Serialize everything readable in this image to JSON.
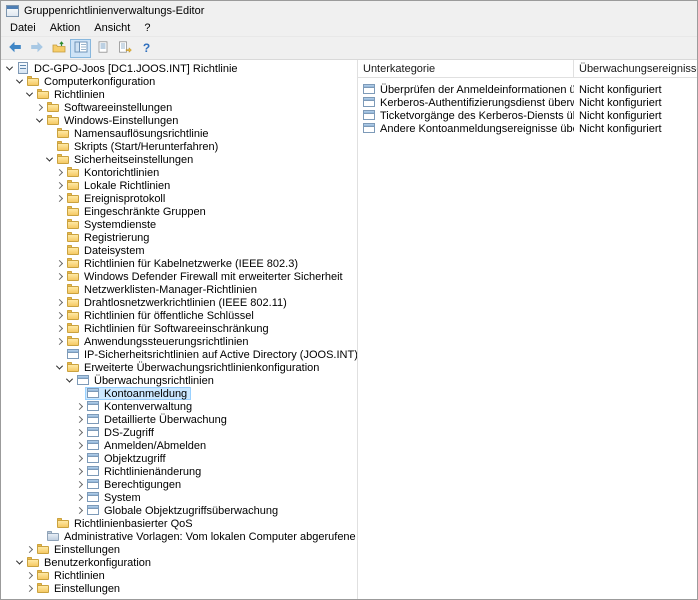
{
  "window": {
    "title": "Gruppenrichtlinienverwaltungs-Editor"
  },
  "menu": {
    "items": [
      "Datei",
      "Aktion",
      "Ansicht",
      "?"
    ]
  },
  "toolbar": {
    "icons": [
      "back-arrow",
      "forward-arrow",
      "up-one-level",
      "show-hide-console-tree",
      "properties",
      "export-list",
      "help"
    ],
    "pressed": "show-hide-console-tree"
  },
  "colors": {
    "selection_bg": "#cce8ff",
    "selection_border": "#99d1ff",
    "folder": "#f5c964"
  },
  "tree": {
    "items": [
      {
        "label": "DC-GPO-Joos [DC1.JOOS.INT] Richtlinie",
        "level": 0,
        "expand": "expanded",
        "icon": "gpo",
        "selected": false
      },
      {
        "label": "Computerkonfiguration",
        "level": 1,
        "expand": "expanded",
        "icon": "folder",
        "selected": false
      },
      {
        "label": "Richtlinien",
        "level": 2,
        "expand": "expanded",
        "icon": "folder",
        "selected": false
      },
      {
        "label": "Softwareeinstellungen",
        "level": 3,
        "expand": "collapsed",
        "icon": "folder",
        "selected": false
      },
      {
        "label": "Windows-Einstellungen",
        "level": 3,
        "expand": "expanded",
        "icon": "folder",
        "selected": false
      },
      {
        "label": "Namensauflösungsrichtlinie",
        "level": 4,
        "expand": "none",
        "icon": "folder",
        "selected": false
      },
      {
        "label": "Skripts (Start/Herunterfahren)",
        "level": 4,
        "expand": "none",
        "icon": "folder",
        "selected": false
      },
      {
        "label": "Sicherheitseinstellungen",
        "level": 4,
        "expand": "expanded",
        "icon": "folder",
        "selected": false
      },
      {
        "label": "Kontorichtlinien",
        "level": 5,
        "expand": "collapsed",
        "icon": "folder",
        "selected": false
      },
      {
        "label": "Lokale Richtlinien",
        "level": 5,
        "expand": "collapsed",
        "icon": "folder",
        "selected": false
      },
      {
        "label": "Ereignisprotokoll",
        "level": 5,
        "expand": "collapsed",
        "icon": "folder",
        "selected": false
      },
      {
        "label": "Eingeschränkte Gruppen",
        "level": 5,
        "expand": "none",
        "icon": "folder",
        "selected": false
      },
      {
        "label": "Systemdienste",
        "level": 5,
        "expand": "none",
        "icon": "folder",
        "selected": false
      },
      {
        "label": "Registrierung",
        "level": 5,
        "expand": "none",
        "icon": "folder",
        "selected": false
      },
      {
        "label": "Dateisystem",
        "level": 5,
        "expand": "none",
        "icon": "folder",
        "selected": false
      },
      {
        "label": "Richtlinien für Kabelnetzwerke (IEEE 802.3)",
        "level": 5,
        "expand": "collapsed",
        "icon": "folder",
        "selected": false
      },
      {
        "label": "Windows Defender Firewall mit erweiterter Sicherheit",
        "level": 5,
        "expand": "collapsed",
        "icon": "folder",
        "selected": false
      },
      {
        "label": "Netzwerklisten-Manager-Richtlinien",
        "level": 5,
        "expand": "none",
        "icon": "folder",
        "selected": false
      },
      {
        "label": "Drahtlosnetzwerkrichtlinien (IEEE 802.11)",
        "level": 5,
        "expand": "collapsed",
        "icon": "folder",
        "selected": false
      },
      {
        "label": "Richtlinien für öffentliche Schlüssel",
        "level": 5,
        "expand": "collapsed",
        "icon": "folder",
        "selected": false
      },
      {
        "label": "Richtlinien für Softwareeinschränkung",
        "level": 5,
        "expand": "collapsed",
        "icon": "folder",
        "selected": false
      },
      {
        "label": "Anwendungssteuerungsrichtlinien",
        "level": 5,
        "expand": "collapsed",
        "icon": "folder",
        "selected": false
      },
      {
        "label": "IP-Sicherheitsrichtlinien auf Active Directory (JOOS.INT)",
        "level": 5,
        "expand": "none",
        "icon": "audit",
        "selected": false
      },
      {
        "label": "Erweiterte Überwachungsrichtlinienkonfiguration",
        "level": 5,
        "expand": "expanded",
        "icon": "folder",
        "selected": false
      },
      {
        "label": "Überwachungsrichtlinien",
        "level": 6,
        "expand": "expanded",
        "icon": "audit",
        "selected": false
      },
      {
        "label": "Kontoanmeldung",
        "level": 7,
        "expand": "none",
        "icon": "audit",
        "selected": true
      },
      {
        "label": "Kontenverwaltung",
        "level": 7,
        "expand": "collapsed",
        "icon": "audit",
        "selected": false
      },
      {
        "label": "Detaillierte Überwachung",
        "level": 7,
        "expand": "collapsed",
        "icon": "audit",
        "selected": false
      },
      {
        "label": "DS-Zugriff",
        "level": 7,
        "expand": "collapsed",
        "icon": "audit",
        "selected": false
      },
      {
        "label": "Anmelden/Abmelden",
        "level": 7,
        "expand": "collapsed",
        "icon": "audit",
        "selected": false
      },
      {
        "label": "Objektzugriff",
        "level": 7,
        "expand": "collapsed",
        "icon": "audit",
        "selected": false
      },
      {
        "label": "Richtlinienänderung",
        "level": 7,
        "expand": "collapsed",
        "icon": "audit",
        "selected": false
      },
      {
        "label": "Berechtigungen",
        "level": 7,
        "expand": "collapsed",
        "icon": "audit",
        "selected": false
      },
      {
        "label": "System",
        "level": 7,
        "expand": "collapsed",
        "icon": "audit",
        "selected": false
      },
      {
        "label": "Globale Objektzugriffsüberwachung",
        "level": 7,
        "expand": "collapsed",
        "icon": "audit",
        "selected": false
      },
      {
        "label": "Richtlinienbasierter QoS",
        "level": 4,
        "expand": "none",
        "icon": "folder",
        "selected": false
      },
      {
        "label": "Administrative Vorlagen: Vom lokalen Computer abgerufene Richtliniendefir",
        "level": 3,
        "expand": "none",
        "icon": "admx",
        "selected": false
      },
      {
        "label": "Einstellungen",
        "level": 2,
        "expand": "collapsed",
        "icon": "folder",
        "selected": false
      },
      {
        "label": "Benutzerkonfiguration",
        "level": 1,
        "expand": "expanded",
        "icon": "folder",
        "selected": false
      },
      {
        "label": "Richtlinien",
        "level": 2,
        "expand": "collapsed",
        "icon": "folder",
        "selected": false
      },
      {
        "label": "Einstellungen",
        "level": 2,
        "expand": "collapsed",
        "icon": "folder",
        "selected": false
      }
    ]
  },
  "list": {
    "columns": [
      {
        "label": "Unterkategorie"
      },
      {
        "label": "Überwachungsereignisse"
      }
    ],
    "rows": [
      {
        "subcategory": "Überprüfen der Anmeldeinformationen überwachen",
        "value": "Nicht konfiguriert"
      },
      {
        "subcategory": "Kerberos-Authentifizierungsdienst überwachen",
        "value": "Nicht konfiguriert"
      },
      {
        "subcategory": "Ticketvorgänge des Kerberos-Diensts überwachen",
        "value": "Nicht konfiguriert"
      },
      {
        "subcategory": "Andere Kontoanmeldungsereignisse überwachen",
        "value": "Nicht konfiguriert"
      }
    ]
  },
  "selection": {
    "tree_item": "Kontoanmeldung"
  }
}
